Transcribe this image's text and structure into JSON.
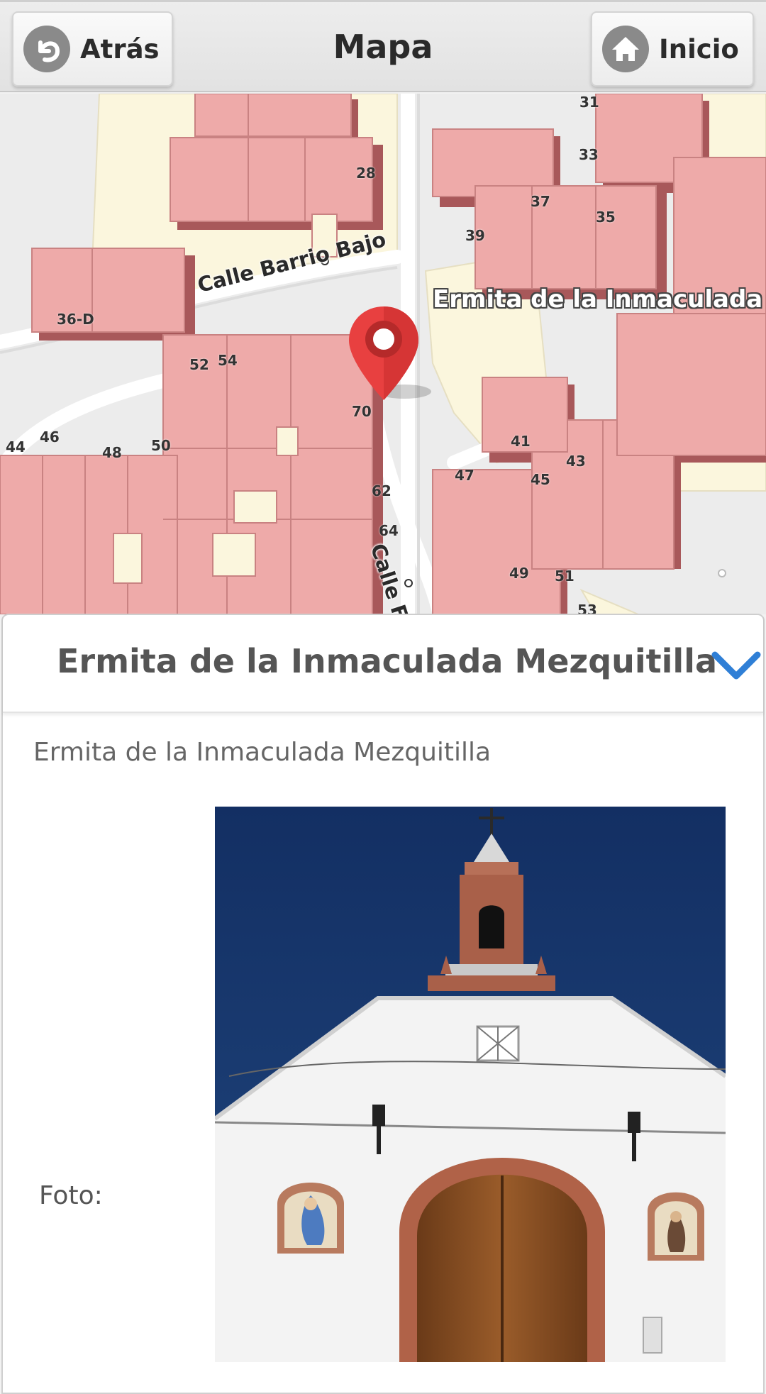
{
  "header": {
    "back_label": "Atrás",
    "title": "Mapa",
    "home_label": "Inicio"
  },
  "map": {
    "poi_label": "Ermita de la Inmaculada Me",
    "streets": [
      "Calle Barrio Bajo",
      "Calle Fuente"
    ],
    "house_numbers": [
      "31",
      "33",
      "28",
      "37",
      "35",
      "39",
      "36-D",
      "52",
      "54",
      "70",
      "41",
      "43",
      "44",
      "46",
      "48",
      "50",
      "47",
      "45",
      "62",
      "64",
      "49",
      "51",
      "53"
    ]
  },
  "panel": {
    "title": "Ermita de la Inmaculada Mezquitilla",
    "subtitle": "Ermita de la Inmaculada Mezquitilla",
    "photo_label": "Foto:"
  },
  "colors": {
    "building": "#eeaaa9",
    "building_shadow": "#a8585a",
    "block": "#fbf6dd",
    "road": "#ffffff",
    "marker": "#e84040",
    "accent": "#2f7fd6"
  }
}
